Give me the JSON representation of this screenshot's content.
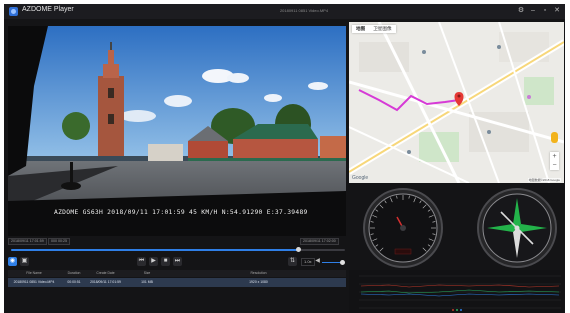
{
  "app": {
    "title": "AZDOME Player",
    "file_title": "20180911 0851 Video.MP4",
    "window_buttons": [
      "gear-icon",
      "minimize-icon",
      "restore-icon",
      "close-icon"
    ]
  },
  "video": {
    "overlay": "AZDOME GS63H 2018/09/11 17:01:59  45 KM/H N:54.91290 E:37.39489"
  },
  "playback": {
    "current_time": "2018/09/11 17:01:59",
    "segment": "000 00:25",
    "end_time": "2018/09/11 17:02:00",
    "duration": "00:00:59",
    "progress": 0.86,
    "speed": "1.0x",
    "volume": 1.0
  },
  "table": {
    "headers": [
      "File Name",
      "Duration",
      "Create Date",
      "Size",
      "Resolution"
    ],
    "rows": [
      [
        "20180911 0851 Video.MP4",
        "00:00:51",
        "2018/09/11 17:01:59",
        "101 MB",
        "1920 x 1080"
      ]
    ]
  },
  "map": {
    "tabs": [
      "地图",
      "卫星图像"
    ],
    "footer": "地图数据©2018 Google",
    "logo": "Google"
  },
  "colors": {
    "accent": "#2f7fe6",
    "route": "#d63ad6",
    "pin": "#e53935",
    "compass_green": "#23b34a"
  }
}
